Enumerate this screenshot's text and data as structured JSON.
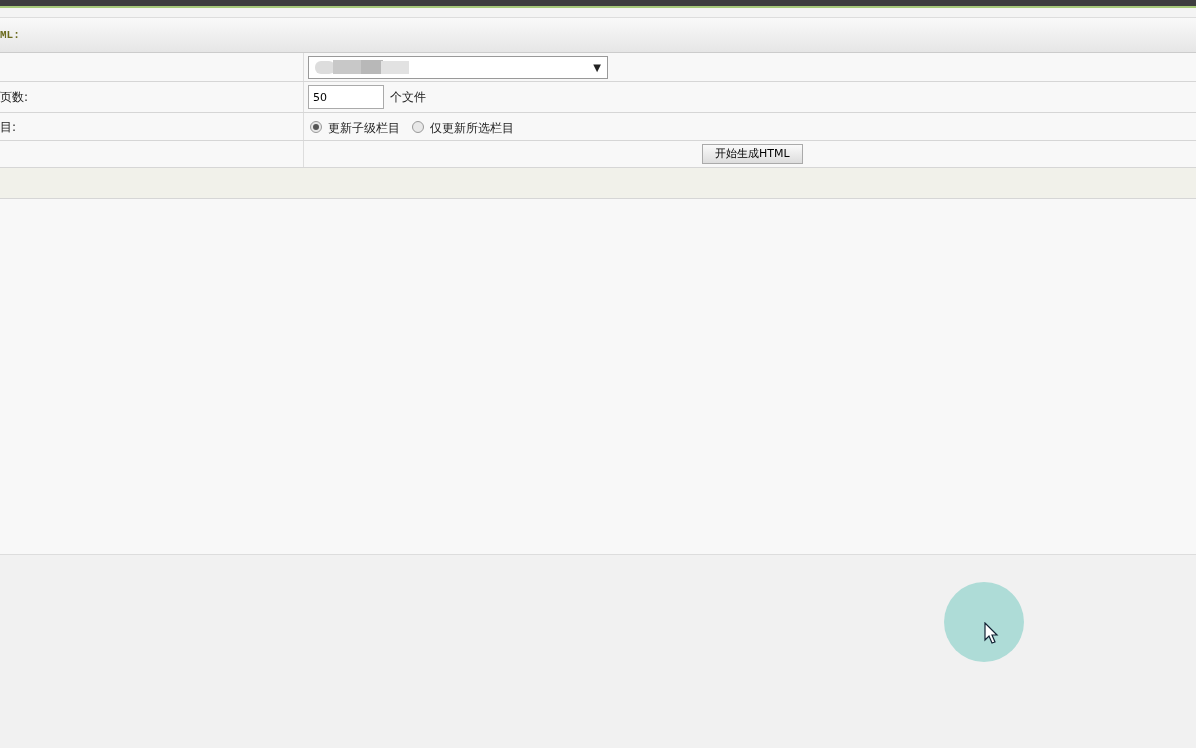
{
  "header": {
    "title": "ML:"
  },
  "rows": [
    {
      "kind": "select",
      "label": "",
      "caret": "▼"
    },
    {
      "kind": "number",
      "label": "页数:",
      "value": "50",
      "suffix": "个文件"
    },
    {
      "kind": "radio",
      "label": "目:",
      "options": [
        {
          "label": "更新子级栏目",
          "selected": true
        },
        {
          "label": "仅更新所选栏目",
          "selected": false
        }
      ]
    },
    {
      "kind": "button",
      "label": "",
      "button": "开始生成HTML"
    }
  ]
}
